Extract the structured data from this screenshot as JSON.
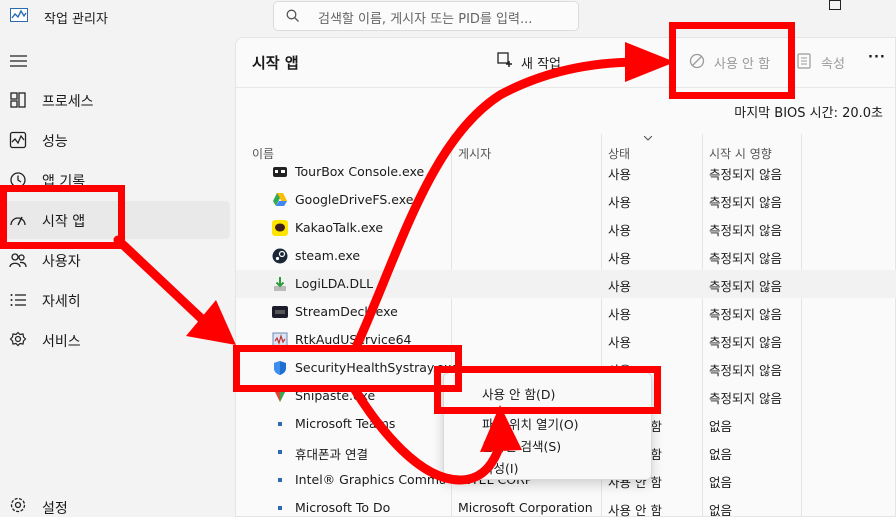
{
  "app": {
    "title": "작업 관리자",
    "search_placeholder": "검색할 이름, 게시자 또는 PID를 입력..."
  },
  "sidebar": {
    "items": [
      {
        "label": "프로세스",
        "icon": "processes-icon"
      },
      {
        "label": "성능",
        "icon": "performance-icon"
      },
      {
        "label": "앱 기록",
        "icon": "app-history-icon"
      },
      {
        "label": "시작 앱",
        "icon": "startup-icon",
        "active": true
      },
      {
        "label": "사용자",
        "icon": "users-icon"
      },
      {
        "label": "자세히",
        "icon": "details-icon"
      },
      {
        "label": "서비스",
        "icon": "services-icon"
      }
    ],
    "settings_label": "설정"
  },
  "main": {
    "page_title": "시작 앱",
    "toolbar": {
      "new_task_label": "새 작업",
      "disable_label": "사용 안 함",
      "properties_label": "속성"
    },
    "bios_text": "마지막 BIOS 시간:  20.0초",
    "columns": [
      "이름",
      "게시자",
      "상태",
      "시작 시 영향"
    ],
    "rows": [
      {
        "name": "TourBox Console.exe",
        "publisher": "",
        "status": "사용",
        "impact": "측정되지 않음"
      },
      {
        "name": "GoogleDriveFS.exe",
        "publisher": "",
        "status": "사용",
        "impact": "측정되지 않음"
      },
      {
        "name": "KakaoTalk.exe",
        "publisher": "",
        "status": "사용",
        "impact": "측정되지 않음"
      },
      {
        "name": "steam.exe",
        "publisher": "",
        "status": "사용",
        "impact": "측정되지 않음"
      },
      {
        "name": "LogiLDA.DLL",
        "publisher": "",
        "status": "사용",
        "impact": "측정되지 않음"
      },
      {
        "name": "StreamDeck.exe",
        "publisher": "",
        "status": "사용",
        "impact": "측정되지 않음"
      },
      {
        "name": "RtkAudUService64",
        "publisher": "",
        "status": "사용",
        "impact": "측정되지 않음"
      },
      {
        "name": "SecurityHealthSystray.exe",
        "publisher": "",
        "status": "사용",
        "impact": "측정되지 않음"
      },
      {
        "name": "Snipaste.exe",
        "publisher": "",
        "status": "사용",
        "impact": "측정되지 않음"
      },
      {
        "name": "Microsoft Teams",
        "publisher": "",
        "status": "사용 안 함",
        "impact": "없음"
      },
      {
        "name": "휴대폰과 연결",
        "publisher": "",
        "status": "사용 안 함",
        "impact": "없음"
      },
      {
        "name": "Intel® Graphics Command Center",
        "publisher": "INTEL CORP",
        "status": "사용 안 함",
        "impact": "없음"
      },
      {
        "name": "Microsoft To Do",
        "publisher": "Microsoft Corporation",
        "status": "사용 안 함",
        "impact": "없음"
      }
    ]
  },
  "context_menu": {
    "items": [
      "사용 안 함(D)",
      "파일 위치 열기(O)",
      "온라인 검색(S)",
      "속성(I)"
    ]
  },
  "annotation": {
    "color": "#ff0000"
  }
}
